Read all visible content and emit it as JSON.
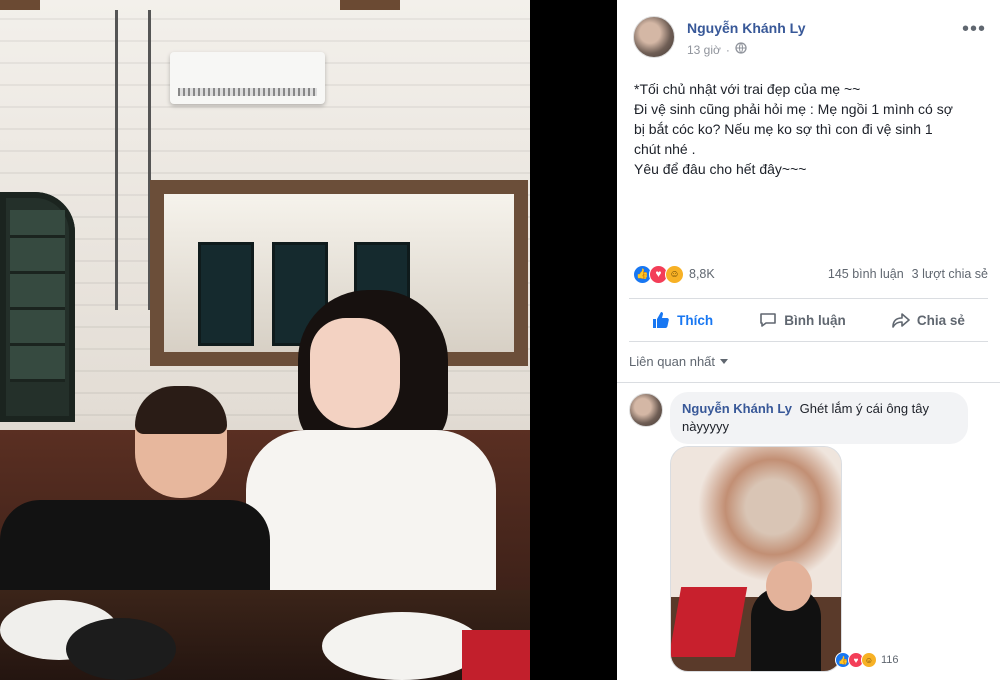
{
  "post": {
    "author": "Nguyễn Khánh Ly",
    "time": "13 giờ",
    "text_lines": [
      "*Tối chủ nhật với trai đẹp của mẹ ~~",
      "Đi vệ sinh cũng phải hỏi mẹ : Mẹ ngồi 1 mình có sợ",
      "bị bắt cóc ko? Nếu mẹ ko sợ thì con đi vệ sinh 1",
      "chút nhé .",
      "Yêu để đâu cho hết đây~~~"
    ]
  },
  "reactions": {
    "count": "8,8K",
    "comments": "145 bình luận",
    "shares": "3 lượt chia sẻ"
  },
  "actions": {
    "like": "Thích",
    "comment": "Bình luận",
    "share": "Chia sẻ"
  },
  "comments_sort": "Liên quan nhất",
  "comment": {
    "author": "Nguyễn Khánh Ly",
    "text": "Ghét lắm ý cái ông tây nàyyyyy",
    "reaction_count": "116"
  },
  "colors": {
    "link_blue": "#385898",
    "like_blue": "#1877f2",
    "muted": "#606770"
  },
  "icons": [
    "globe-icon",
    "more-icon",
    "like-icon",
    "comment-icon",
    "share-icon",
    "caret-down-icon"
  ]
}
